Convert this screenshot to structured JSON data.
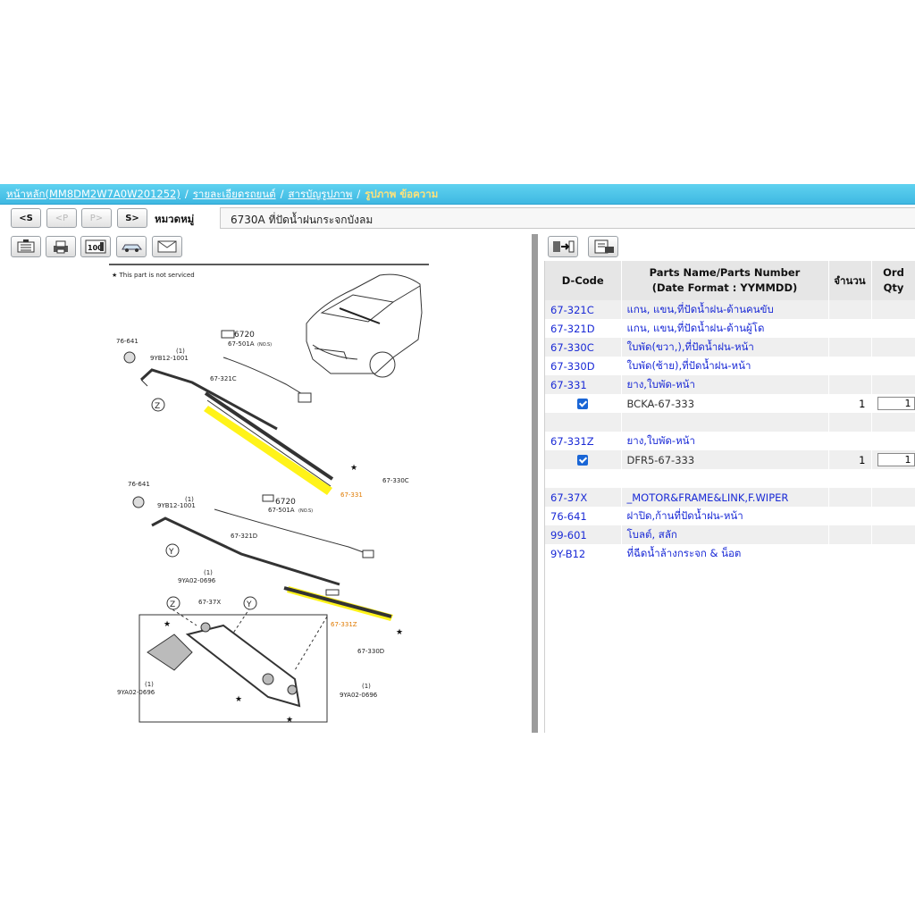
{
  "breadcrumb": {
    "items": [
      "หน้าหลัก(MM8DM2W7A0W201252)",
      "รายละเอียดรถยนต์",
      "สารบัญรูปภาพ"
    ],
    "current": "รูปภาพ ข้อความ"
  },
  "nav": {
    "first": "<S",
    "prev": "<P",
    "next": "P>",
    "last": "S>",
    "category_label": "หมวดหมู่",
    "category_value": "6730A  ที่ปัดน้ำฝนกระจกบังลม"
  },
  "tools": [
    "list-icon",
    "printer-icon",
    "zoom-100-icon",
    "car-icon",
    "mail-icon"
  ],
  "right_tools": [
    "export-icon",
    "print-list-icon"
  ],
  "diagram": {
    "legend": "★ This part is not serviced",
    "callouts": {
      "c76641a": "76-641",
      "c9yb12a": "9YB12-1001",
      "c1a": "(1)",
      "c6720a": "67-501A",
      "c6720a_top": "6720",
      "nos_a": "(NO.S)",
      "c67321c": "67-321C",
      "c67330c": "67-330C",
      "c67331": "67-331",
      "c76641b": "76-641",
      "c9yb12b": "9YB12-1001",
      "c1b": "(1)",
      "c6720b_top": "6720",
      "c6720b": "67-501A",
      "nos_b": "(NO.S)",
      "c67321d": "67-321D",
      "c9ya02a": "9YA02-0696",
      "c1c": "(1)",
      "c6737x": "67-37X",
      "c67331z": "67-331Z",
      "c67330d": "67-330D",
      "c9ya02b": "9YA02-0696",
      "c1d": "(1)",
      "c9ya02c": "9YA02-0696",
      "c1e": "(1)",
      "z": "Z",
      "y": "Y"
    }
  },
  "table": {
    "headers": {
      "dcode": "D-Code",
      "name_line1": "Parts Name/Parts Number",
      "name_line2": "(Date Format : YYMMDD)",
      "qty_line1": "จำนวน",
      "ord_line1": "Ord",
      "ord_line2": "Qty"
    },
    "rows": [
      {
        "code": "67-321C",
        "name": "แกน, แขน,ที่ปัดน้ำฝน-ด้านคนขับ",
        "qty": "",
        "ord": ""
      },
      {
        "code": "67-321D",
        "name": "แกน, แขน,ที่ปัดน้ำฝน-ด้านผู้โด",
        "qty": "",
        "ord": ""
      },
      {
        "code": "67-330C",
        "name": "ใบพัด(ขวา,),ที่ปัดน้ำฝน-หน้า",
        "qty": "",
        "ord": ""
      },
      {
        "code": "67-330D",
        "name": "ใบพัด(ซ้าย),ที่ปัดน้ำฝน-หน้า",
        "qty": "",
        "ord": ""
      },
      {
        "code": "67-331",
        "name": "ยาง,ใบพัด-หน้า",
        "qty": "",
        "ord": ""
      },
      {
        "code": "",
        "name": "BCKA-67-333",
        "qty": "1",
        "ord": "1",
        "checked": true
      },
      {
        "code": "",
        "name": "",
        "qty": "",
        "ord": ""
      },
      {
        "code": "67-331Z",
        "name": "ยาง,ใบพัด-หน้า",
        "qty": "",
        "ord": ""
      },
      {
        "code": "",
        "name": "DFR5-67-333",
        "qty": "1",
        "ord": "1",
        "checked": true
      },
      {
        "code": "",
        "name": "",
        "qty": "",
        "ord": ""
      },
      {
        "code": "67-37X",
        "name": "_MOTOR&FRAME&LINK,F.WIPER",
        "qty": "",
        "ord": ""
      },
      {
        "code": "76-641",
        "name": "ฝาปิด,ก้านที่ปัดน้ำฝน-หน้า",
        "qty": "",
        "ord": ""
      },
      {
        "code": "99-601",
        "name": "โบลต์, สลัก",
        "qty": "",
        "ord": ""
      },
      {
        "code": "9Y-B12",
        "name": "ที่ฉีดน้ำล้างกระจก & น็อต",
        "qty": "",
        "ord": ""
      }
    ]
  },
  "colors": {
    "header_blue": "#3fb8e2",
    "link": "#1a2ad6",
    "highlight": "#fff200",
    "callout_orange": "#e07a00"
  }
}
